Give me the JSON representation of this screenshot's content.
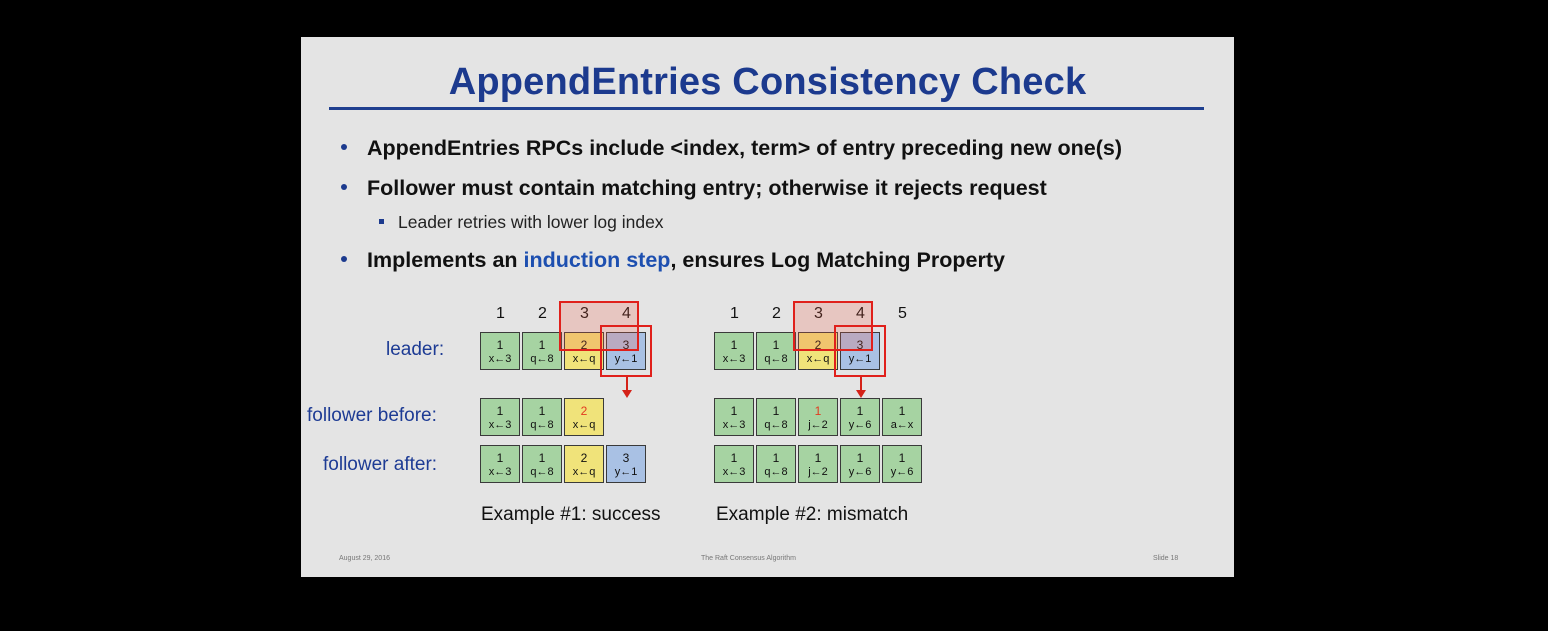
{
  "slide": {
    "title": "AppendEntries Consistency Check",
    "bullets": [
      "AppendEntries RPCs include <index, term> of entry preceding new one(s)",
      "Follower must contain matching entry; otherwise it rejects request"
    ],
    "sub_bullet": "Leader retries with lower log index",
    "bullet3_pre": "Implements an ",
    "bullet3_hl": "induction step",
    "bullet3_post": ", ensures Log Matching Property",
    "row_labels": {
      "leader": "leader:",
      "before": "follower before:",
      "after": "follower after:"
    },
    "captions": [
      "Example #1: success",
      "Example #2: mismatch"
    ],
    "footer": {
      "date": "August 29, 2016",
      "center": "The Raft Consensus Algorithm",
      "slide": "Slide 18"
    },
    "colors": {
      "green": "#a6d3a2",
      "yellow": "#f0e37a",
      "blue": "#a9c1e4",
      "red": "#e0201b",
      "title": "#1c3a8e"
    }
  },
  "examples": [
    {
      "indices": [
        "1",
        "2",
        "3",
        "4"
      ],
      "leader": [
        {
          "term": "1",
          "cmd": "x←3",
          "color": "green"
        },
        {
          "term": "1",
          "cmd": "q←8",
          "color": "green"
        },
        {
          "term": "2",
          "cmd": "x←q",
          "color": "yellow"
        },
        {
          "term": "3",
          "cmd": "y←1",
          "color": "blue"
        }
      ],
      "follower_before": [
        {
          "term": "1",
          "cmd": "x←3",
          "color": "green"
        },
        {
          "term": "1",
          "cmd": "q←8",
          "color": "green"
        },
        {
          "term": "2",
          "cmd": "x←q",
          "color": "yellow",
          "term_red": true
        }
      ],
      "follower_after": [
        {
          "term": "1",
          "cmd": "x←3",
          "color": "green"
        },
        {
          "term": "1",
          "cmd": "q←8",
          "color": "green"
        },
        {
          "term": "2",
          "cmd": "x←q",
          "color": "yellow"
        },
        {
          "term": "3",
          "cmd": "y←1",
          "color": "blue"
        }
      ]
    },
    {
      "indices": [
        "1",
        "2",
        "3",
        "4",
        "5"
      ],
      "leader": [
        {
          "term": "1",
          "cmd": "x←3",
          "color": "green"
        },
        {
          "term": "1",
          "cmd": "q←8",
          "color": "green"
        },
        {
          "term": "2",
          "cmd": "x←q",
          "color": "yellow"
        },
        {
          "term": "3",
          "cmd": "y←1",
          "color": "blue"
        }
      ],
      "follower_before": [
        {
          "term": "1",
          "cmd": "x←3",
          "color": "green"
        },
        {
          "term": "1",
          "cmd": "q←8",
          "color": "green"
        },
        {
          "term": "1",
          "cmd": "j←2",
          "color": "green",
          "term_red": true
        },
        {
          "term": "1",
          "cmd": "y←6",
          "color": "green"
        },
        {
          "term": "1",
          "cmd": "a←x",
          "color": "green"
        }
      ],
      "follower_after": [
        {
          "term": "1",
          "cmd": "x←3",
          "color": "green"
        },
        {
          "term": "1",
          "cmd": "q←8",
          "color": "green"
        },
        {
          "term": "1",
          "cmd": "j←2",
          "color": "green"
        },
        {
          "term": "1",
          "cmd": "y←6",
          "color": "green"
        },
        {
          "term": "1",
          "cmd": "y←6",
          "color": "green"
        }
      ]
    }
  ]
}
